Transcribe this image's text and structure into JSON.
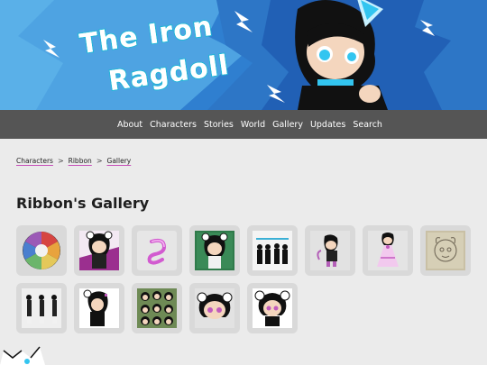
{
  "banner": {
    "logo_line1": "The Iron",
    "logo_line2": "Ragdoll",
    "colors": {
      "sky": "#2f7fd0",
      "burst_light": "#5ab0e8",
      "burst_dark": "#2160b5",
      "logo_outline": "#1db7d6"
    }
  },
  "nav": {
    "items": [
      "About",
      "Characters",
      "Stories",
      "World",
      "Gallery",
      "Updates",
      "Search"
    ]
  },
  "breadcrumb": {
    "items": [
      "Characters",
      "Ribbon",
      "Gallery"
    ],
    "separator": ">"
  },
  "page_title": "Ribbon's Gallery",
  "gallery": {
    "thumbnails": [
      {
        "name": "color-wheel",
        "icon": "color-wheel-thumb"
      },
      {
        "name": "ribbon-purple-pose",
        "icon": "character-thumb"
      },
      {
        "name": "ribbon-swirl-symbol",
        "icon": "swirl-thumb"
      },
      {
        "name": "ribbon-green-bg",
        "icon": "character-thumb"
      },
      {
        "name": "silhouettes-lineup",
        "icon": "silhouette-thumb"
      },
      {
        "name": "ribbon-chibi-purple",
        "icon": "chibi-thumb"
      },
      {
        "name": "ribbon-dress",
        "icon": "dress-thumb"
      },
      {
        "name": "ribbon-sketch",
        "icon": "sketch-thumb"
      },
      {
        "name": "ribbon-turnaround",
        "icon": "turnaround-thumb"
      },
      {
        "name": "ribbon-portrait",
        "icon": "portrait-thumb"
      },
      {
        "name": "ribbon-sticker-sheet",
        "icon": "sticker-thumb"
      },
      {
        "name": "ribbon-face",
        "icon": "face-thumb"
      },
      {
        "name": "ribbon-bust",
        "icon": "bust-thumb"
      }
    ]
  }
}
